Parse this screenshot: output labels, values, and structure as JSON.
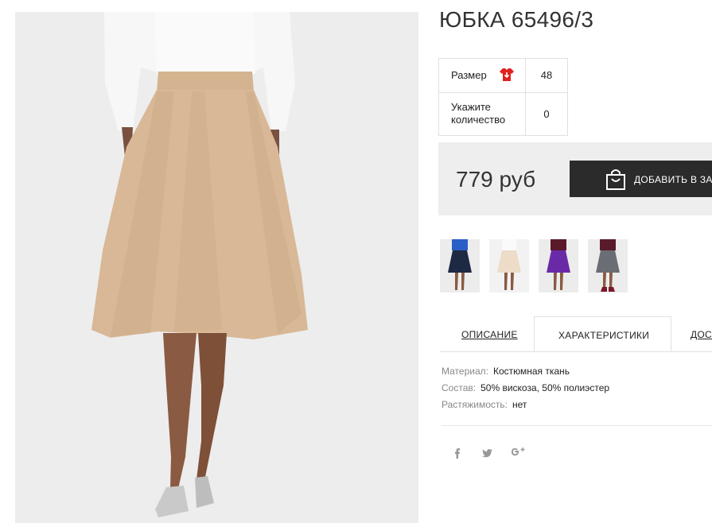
{
  "product": {
    "title": "ЮБКА 65496/3"
  },
  "options": {
    "size_label": "Размер",
    "size_value": "48",
    "qty_label": "Укажите\nколичество",
    "qty_value": "0"
  },
  "price": {
    "text": "779 руб"
  },
  "cart": {
    "button_label": "ДОБАВИТЬ В ЗАКАЗ",
    "icon": "shopping-bag-icon"
  },
  "color_variants": [
    {
      "name": "navy",
      "color": "#1e2a44"
    },
    {
      "name": "beige",
      "color": "#ecdcc8"
    },
    {
      "name": "purple",
      "color": "#6a2aa8"
    },
    {
      "name": "grey",
      "color": "#6a6e74"
    }
  ],
  "tabs": [
    {
      "label": "ОПИСАНИЕ",
      "active": false
    },
    {
      "label": "ХАРАКТЕРИСТИКИ",
      "active": true
    },
    {
      "label": "ДОСТАВКА",
      "active": false
    }
  ],
  "characteristics": [
    {
      "key": "Материал:",
      "value": "Костюмная ткань"
    },
    {
      "key": "Состав:",
      "value": "50% вискоза, 50% полиэстер"
    },
    {
      "key": "Растяжимость:",
      "value": "нет"
    }
  ],
  "social": [
    {
      "name": "facebook-icon",
      "glyph": "f"
    },
    {
      "name": "twitter-icon",
      "glyph": "t"
    },
    {
      "name": "google-plus-icon",
      "glyph": "g+"
    }
  ],
  "colors": {
    "skirt": "#d8b896",
    "dark_button": "#2b2b2b",
    "price_bg": "#eeeeee",
    "size_icon": "#e02020"
  }
}
